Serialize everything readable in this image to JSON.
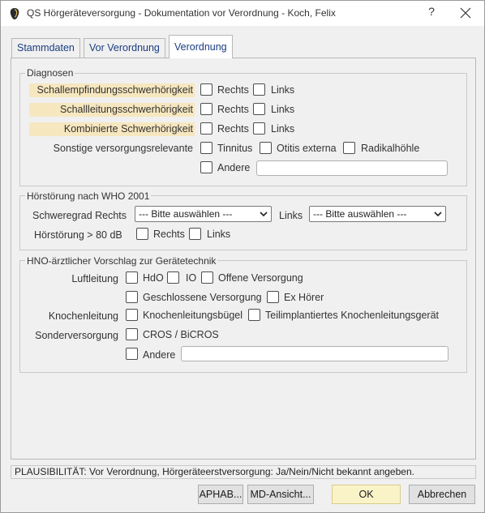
{
  "window": {
    "title": "QS Hörgeräteversorgung - Dokumentation vor Verordnung - Koch, Felix",
    "help_label": "?",
    "close_icon": "close-icon",
    "app_icon": "app-icon"
  },
  "tabs": [
    {
      "label": "Stammdaten",
      "active": false
    },
    {
      "label": "Vor Verordnung",
      "active": false
    },
    {
      "label": "Verordnung",
      "active": true
    }
  ],
  "diagnosen": {
    "legend": "Diagnosen",
    "rows": [
      {
        "label": "Schallempfindungsschwerhörigkeit",
        "options": [
          "Rechts",
          "Links"
        ]
      },
      {
        "label": "Schallleitungsschwerhörigkeit",
        "options": [
          "Rechts",
          "Links"
        ]
      },
      {
        "label": "Kombinierte Schwerhörigkeit",
        "options": [
          "Rechts",
          "Links"
        ]
      },
      {
        "label": "Sonstige versorgungsrelevante",
        "options": [
          "Tinnitus",
          "Otitis externa",
          "Radikalhöhle"
        ]
      }
    ],
    "andere_label": "Andere",
    "andere_value": ""
  },
  "who": {
    "legend": "Hörstörung nach WHO 2001",
    "schweregrad_label": "Schweregrad Rechts",
    "rechts_select": "--- Bitte auswählen ---",
    "links_label": "Links",
    "links_select": "--- Bitte auswählen ---",
    "hoerstoerung_label": "Hörstörung > 80 dB",
    "hoerstoerung_options": [
      "Rechts",
      "Links"
    ]
  },
  "hno": {
    "legend": "HNO-ärztlicher Vorschlag zur Gerätetechnik",
    "luftleitung_label": "Luftleitung",
    "luftleitung_options": [
      "HdO",
      "IO",
      "Offene Versorgung",
      "Geschlossene Versorgung",
      "Ex Hörer"
    ],
    "knochenleitung_label": "Knochenleitung",
    "knochenleitung_options": [
      "Knochenleitungsbügel",
      "Teilimplantiertes Knochenleitungsgerät"
    ],
    "sonder_label": "Sonderversorgung",
    "sonder_options": [
      "CROS / BiCROS"
    ],
    "andere_label": "Andere",
    "andere_value": ""
  },
  "status": {
    "text": "PLAUSIBILITÄT: Vor Verordnung, Hörgeräteerstversorgung: Ja/Nein/Nicht bekannt angeben."
  },
  "buttons": {
    "aphab": "APHAB...",
    "md": "MD-Ansicht...",
    "ok": "OK",
    "cancel": "Abbrechen"
  },
  "colors": {
    "highlight": "#f7e7bf",
    "ok_button": "#fbf3c8",
    "tab_text": "#1a3d80"
  }
}
